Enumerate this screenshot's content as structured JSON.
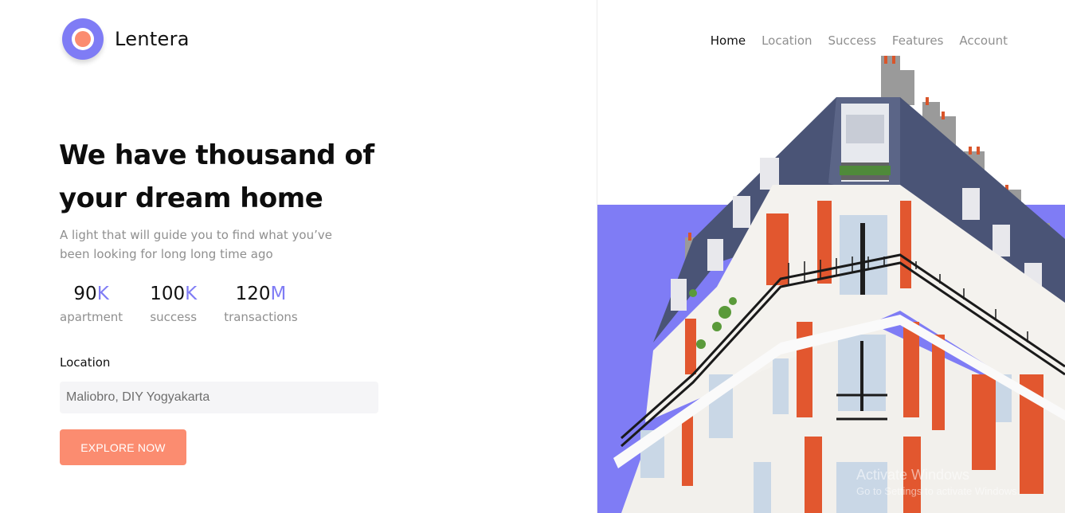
{
  "brand": {
    "name": "Lentera",
    "logo_icon": "lantern-circle-icon",
    "accent": "#7f7cf5",
    "secondary": "#fb8c70"
  },
  "nav": {
    "items": [
      {
        "label": "Home",
        "active": true
      },
      {
        "label": "Location",
        "active": false
      },
      {
        "label": "Success",
        "active": false
      },
      {
        "label": "Features",
        "active": false
      },
      {
        "label": "Account",
        "active": false
      }
    ]
  },
  "hero": {
    "headline_line1": "We have thousand of",
    "headline_line2": "your dream home",
    "subtext_line1": "A light that will guide you to find what you’ve",
    "subtext_line2": "been looking for long long time ago"
  },
  "stats": [
    {
      "value": "90",
      "unit": "K",
      "label": "apartment"
    },
    {
      "value": "100",
      "unit": "K",
      "label": "success"
    },
    {
      "value": "120",
      "unit": "M",
      "label": "transactions"
    }
  ],
  "search": {
    "label": "Location",
    "value": "Maliobro, DIY Yogyakarta",
    "button_label": "EXPLORE NOW"
  },
  "image": {
    "subject": "apartment-building-photo",
    "background_color": "#7f7cf5"
  },
  "watermark": {
    "line1": "Activate Windows",
    "line2": "Go to Settings to activate Windows."
  }
}
